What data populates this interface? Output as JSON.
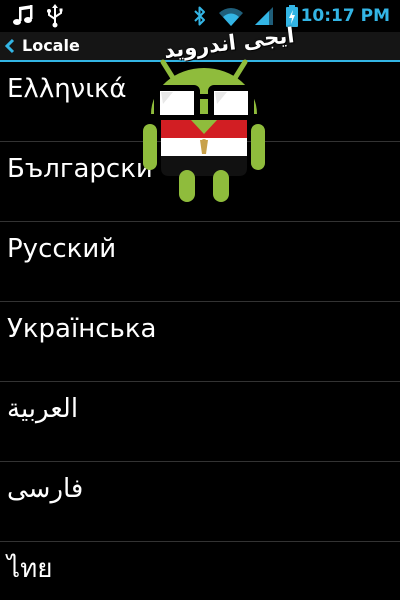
{
  "status_bar": {
    "time": "10:17 PM",
    "icons": [
      "music-icon",
      "usb-icon",
      "bluetooth-icon",
      "wifi-icon",
      "signal-icon",
      "battery-icon"
    ],
    "time_color": "#33b5e5"
  },
  "action_bar": {
    "title": "Locale",
    "back_icon": "chevron-left-icon",
    "accent_color": "#33b5e5"
  },
  "watermark": {
    "text": "ايجى اندرويد",
    "logo": "android-mascot-logo"
  },
  "locales": [
    {
      "label": "Ελληνικά"
    },
    {
      "label": "Български"
    },
    {
      "label": "Русский"
    },
    {
      "label": "Українська"
    },
    {
      "label": "العربية"
    },
    {
      "label": "فارسی"
    },
    {
      "label": "ไทย"
    }
  ]
}
